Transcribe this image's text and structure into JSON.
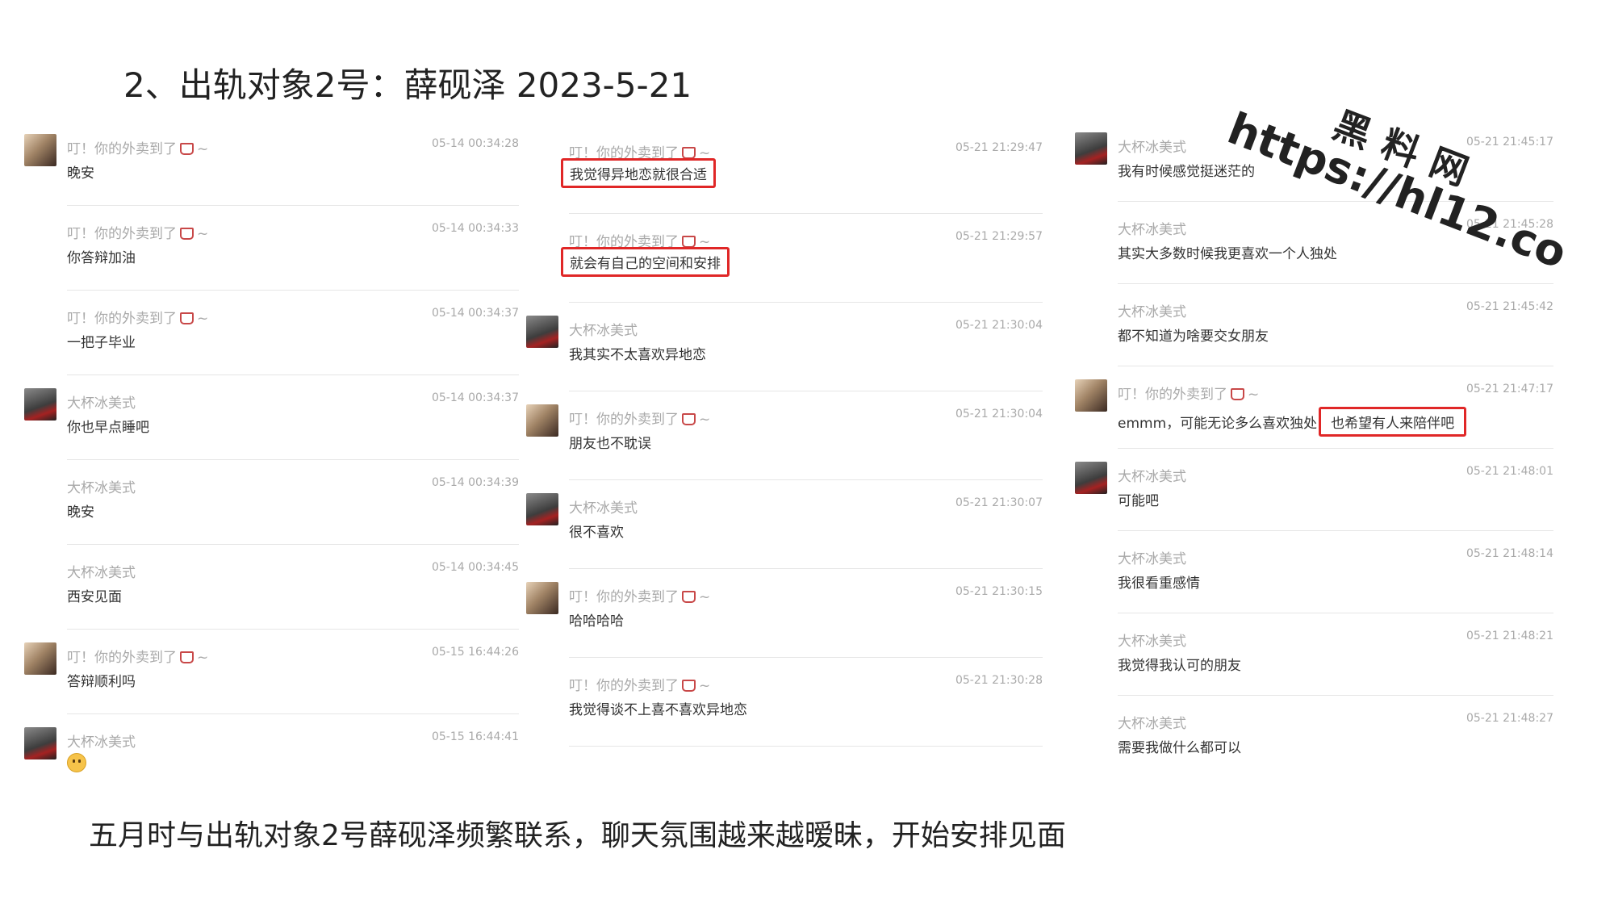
{
  "title": "2、出轨对象2号：薛砚泽 2023-5-21",
  "caption": "五月时与出轨对象2号薛砚泽频繁联系，聊天氛围越来越暧昧，开始安排见面",
  "watermark": {
    "cn": "黑料网",
    "url": "https://hl12.co"
  },
  "names": {
    "me": "叮！你的外卖到了",
    "me_suffix": "~",
    "other": "大杯冰美式"
  },
  "col1": [
    {
      "time": "05-14 00:34:28",
      "text": "晚安"
    },
    {
      "time": "05-14 00:34:33",
      "text": "你答辩加油"
    },
    {
      "time": "05-14 00:34:37",
      "text": "一把子毕业"
    },
    {
      "time": "05-14 00:34:37",
      "text": "你也早点睡吧"
    },
    {
      "time": "05-14 00:34:39",
      "text": "晚安"
    },
    {
      "time": "05-14 00:34:45",
      "text": "西安见面"
    },
    {
      "time": "05-15 16:44:26",
      "text": "答辩顺利吗"
    },
    {
      "time": "05-15 16:44:41",
      "text": ""
    }
  ],
  "col2": [
    {
      "time": "05-21 21:29:47",
      "text": "我觉得异地恋就很合适"
    },
    {
      "time": "05-21 21:29:57",
      "text": "就会有自己的空间和安排"
    },
    {
      "time": "05-21 21:30:04",
      "text": "我其实不太喜欢异地恋"
    },
    {
      "time": "05-21 21:30:04",
      "text": "朋友也不耽误"
    },
    {
      "time": "05-21 21:30:07",
      "text": "很不喜欢"
    },
    {
      "time": "05-21 21:30:15",
      "text": "哈哈哈哈"
    },
    {
      "time": "05-21 21:30:28",
      "text": "我觉得谈不上喜不喜欢异地恋"
    }
  ],
  "col3": [
    {
      "time": "05-21 21:45:17",
      "text": "我有时候感觉挺迷茫的"
    },
    {
      "time": "05-21 21:45:28",
      "text": "其实大多数时候我更喜欢一个人独处"
    },
    {
      "time": "05-21 21:45:42",
      "text": "都不知道为啥要交女朋友"
    },
    {
      "time": "05-21 21:47:17",
      "text": "emmm，可能无论多么喜欢独处",
      "text2": "也希望有人来陪伴吧"
    },
    {
      "time": "05-21 21:48:01",
      "text": "可能吧"
    },
    {
      "time": "05-21 21:48:14",
      "text": "我很看重感情"
    },
    {
      "time": "05-21 21:48:21",
      "text": "我觉得我认可的朋友"
    },
    {
      "time": "05-21 21:48:27",
      "text": "需要我做什么都可以"
    }
  ]
}
